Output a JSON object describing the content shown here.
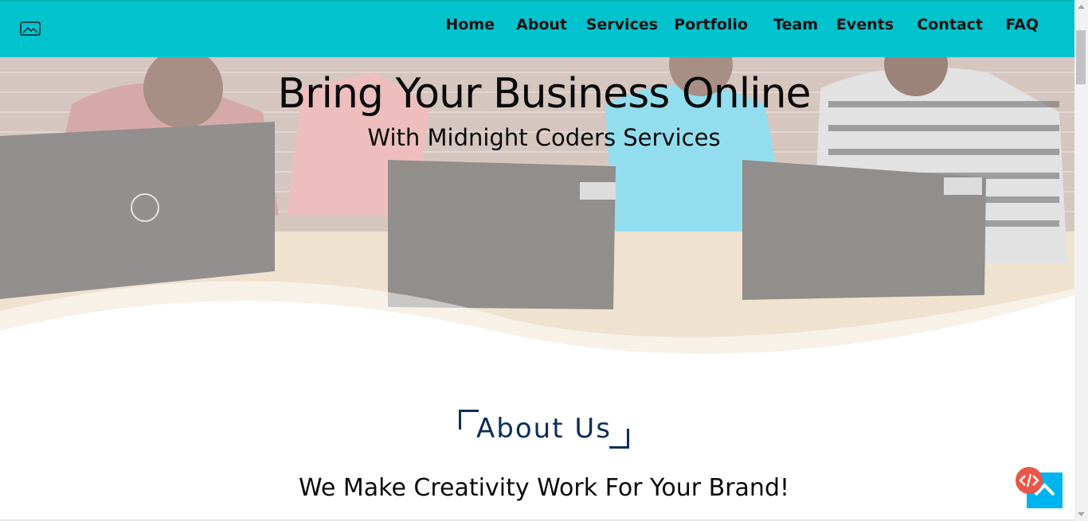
{
  "header": {
    "logo_icon": "image-icon",
    "background_color": "#00c3ce",
    "nav": [
      {
        "label": "Home"
      },
      {
        "label": "About"
      },
      {
        "label": "Services"
      },
      {
        "label": "Portfolio"
      },
      {
        "label": "Team"
      },
      {
        "label": "Events"
      },
      {
        "label": "Contact"
      },
      {
        "label": "FAQ"
      }
    ]
  },
  "hero": {
    "title": "Bring Your Business Online",
    "subtitle": "With Midnight Coders Services"
  },
  "about": {
    "title": "About Us",
    "tagline": "We Make Creativity Work For Your Brand!",
    "title_color": "#0b2e59"
  },
  "floating": {
    "back_to_top_icon": "chevron-up-icon",
    "back_to_top_color": "#00b4f0",
    "code_badge_icon": "code-icon",
    "code_badge_color": "#e8574a"
  }
}
